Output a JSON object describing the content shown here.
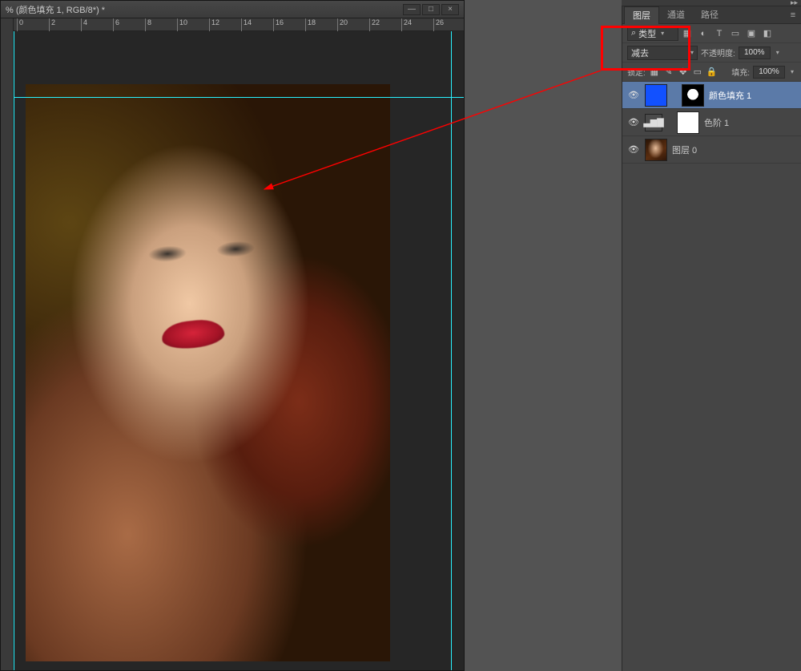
{
  "document": {
    "title": "% (颜色填充 1, RGB/8*) *",
    "win": {
      "min": "—",
      "max": "□",
      "close": "×"
    },
    "ruler_marks": [
      0,
      2,
      4,
      6,
      8,
      10,
      12,
      14,
      16,
      18,
      20,
      22,
      24,
      26
    ]
  },
  "panel": {
    "collapse_glyph": "▸▸",
    "tabs": {
      "layers": "图层",
      "channels": "通道",
      "paths": "路径"
    },
    "menu_glyph": "≡",
    "filter": {
      "search_glyph": "⌕",
      "label": "类型",
      "icons": {
        "pixel": "▦",
        "adjust": "◐",
        "type": "T",
        "shape": "▭",
        "smart": "▣",
        "artbd": "◧"
      }
    },
    "blend": {
      "mode": "减去",
      "opacity_label": "不透明度:",
      "opacity_value": "100%"
    },
    "lock": {
      "label": "锁定:",
      "icons": {
        "trans": "▦",
        "brush": "✎",
        "move": "✥",
        "artb": "▭",
        "all": "🔒"
      },
      "fill_label": "填充:",
      "fill_value": "100%"
    },
    "layers": [
      {
        "eye": "👁",
        "name": "颜色填充 1",
        "kind": "fill",
        "selected": true
      },
      {
        "eye": "👁",
        "name": "色阶 1",
        "kind": "levels",
        "selected": false,
        "adj_glyph": "▃▆▇"
      },
      {
        "eye": "👁",
        "name": "图层 0",
        "kind": "pixel",
        "selected": false
      }
    ]
  }
}
